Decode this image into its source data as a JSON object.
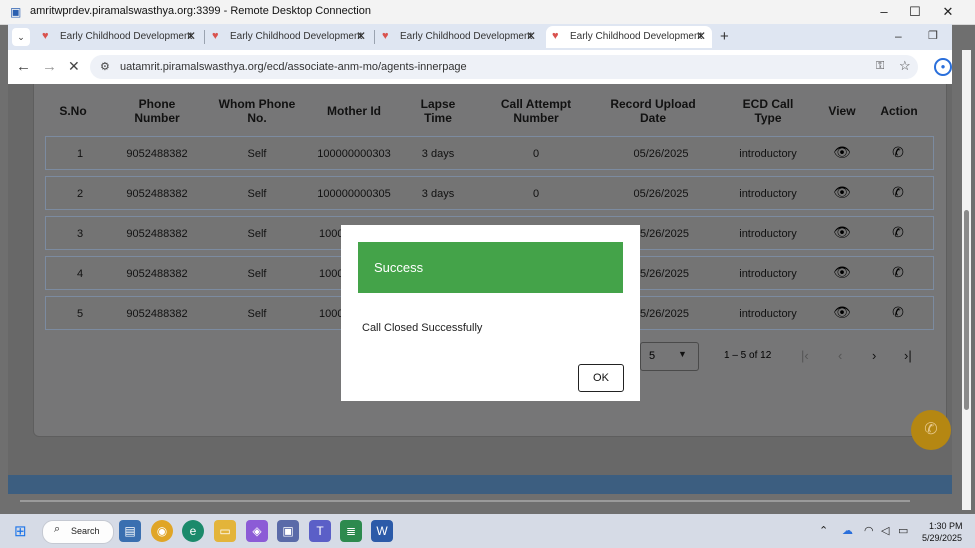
{
  "window": {
    "title": "amritwprdev.piramalswasthya.org:3399 - Remote Desktop Connection",
    "icon": "remote-desktop-icon",
    "controls": [
      "–",
      "☐",
      "✕"
    ]
  },
  "browser": {
    "tabs": [
      {
        "label": "Early Childhood Development",
        "active": false
      },
      {
        "label": "Early Childhood Development",
        "active": false
      },
      {
        "label": "Early Childhood Development",
        "active": false
      },
      {
        "label": "Early Childhood Development",
        "active": true
      }
    ],
    "new_tab": "+",
    "url": "uatamrit.piramalswasthya.org/ecd/associate-anm-mo/agents-innerpage"
  },
  "table": {
    "headers": [
      {
        "l1": "S.No",
        "l2": ""
      },
      {
        "l1": "Phone",
        "l2": "Number"
      },
      {
        "l1": "Whom Phone",
        "l2": "No."
      },
      {
        "l1": "Mother Id",
        "l2": ""
      },
      {
        "l1": "Lapse",
        "l2": "Time"
      },
      {
        "l1": "Call Attempt",
        "l2": "Number"
      },
      {
        "l1": "Record Upload",
        "l2": "Date"
      },
      {
        "l1": "ECD Call",
        "l2": "Type"
      },
      {
        "l1": "View",
        "l2": ""
      },
      {
        "l1": "Action",
        "l2": ""
      }
    ],
    "rows": [
      {
        "sno": "1",
        "phone": "9052488382",
        "whom": "Self",
        "mother_id": "100000000303",
        "lapse": "3 days",
        "attempt": "0",
        "date": "05/26/2025",
        "type": "introductory"
      },
      {
        "sno": "2",
        "phone": "9052488382",
        "whom": "Self",
        "mother_id": "100000000305",
        "lapse": "3 days",
        "attempt": "0",
        "date": "05/26/2025",
        "type": "introductory"
      },
      {
        "sno": "3",
        "phone": "9052488382",
        "whom": "Self",
        "mother_id": "1000",
        "lapse": "",
        "attempt": "",
        "date": "5/26/2025",
        "type": "introductory"
      },
      {
        "sno": "4",
        "phone": "9052488382",
        "whom": "Self",
        "mother_id": "1000",
        "lapse": "",
        "attempt": "",
        "date": "5/26/2025",
        "type": "introductory"
      },
      {
        "sno": "5",
        "phone": "9052488382",
        "whom": "Self",
        "mother_id": "1000",
        "lapse": "",
        "attempt": "",
        "date": "5/26/2025",
        "type": "introductory"
      }
    ],
    "view_icon": "eye-icon",
    "action_icon": "phone-icon"
  },
  "pagination": {
    "page_size": "5",
    "range": "1 – 5 of 12",
    "first": "|‹",
    "prev": "‹",
    "next": "›",
    "last": "›|"
  },
  "modal": {
    "title": "Success",
    "message": "Call Closed Successfully",
    "ok_label": "OK",
    "header_color": "#44a349"
  },
  "taskbar": {
    "search_label": "Search",
    "time": "1:30 PM",
    "date": "5/29/2025"
  }
}
